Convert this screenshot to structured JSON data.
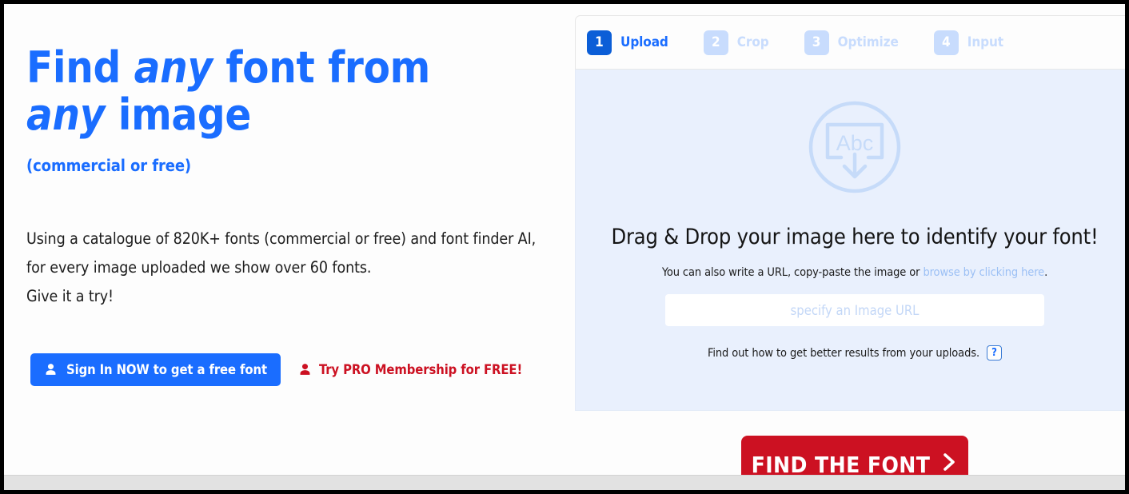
{
  "hero": {
    "headline_part1": "Find ",
    "headline_em1": "any",
    "headline_part2": " font from ",
    "headline_em2": "any",
    "headline_part3": " image",
    "subheadline": "(commercial or free)",
    "body_line1": "Using a catalogue of 820K+ fonts (commercial or free) and font finder AI,",
    "body_line2": "for every image uploaded we show over 60 fonts.",
    "body_line3": "Give it a try!",
    "signin_label": "Sign In NOW to get a free font",
    "signin_icon": "person-icon",
    "pro_label": "Try PRO Membership for FREE!",
    "pro_icon": "person-icon"
  },
  "steps": [
    {
      "number": "1",
      "label": "Upload",
      "state": "active"
    },
    {
      "number": "2",
      "label": "Crop",
      "state": "disabled"
    },
    {
      "number": "3",
      "label": "Optimize",
      "state": "disabled"
    },
    {
      "number": "4",
      "label": "Input",
      "state": "disabled"
    }
  ],
  "dropzone": {
    "icon_name": "image-upload-icon",
    "icon_glyph_text": "Abc",
    "title": "Drag & Drop your image here to identify your font!",
    "sub_prefix": "You can also write a URL, copy-paste the image or ",
    "sub_link": "browse by clicking here",
    "sub_suffix": ".",
    "url_placeholder": "specify an Image URL",
    "url_value": "",
    "help_text": "Find out how to get better results from your uploads.",
    "help_badge": "?"
  },
  "find_button": {
    "label": "FIND THE FONT",
    "icon": "chevron-right-icon"
  },
  "colors": {
    "brand_blue": "#1a6dff",
    "active_step_blue": "#0b5ed7",
    "disabled_step_blue": "#c8dcfd",
    "dropzone_bg": "#e9f0fd",
    "accent_red": "#cc1122",
    "link_blue": "#9cc0f5"
  }
}
